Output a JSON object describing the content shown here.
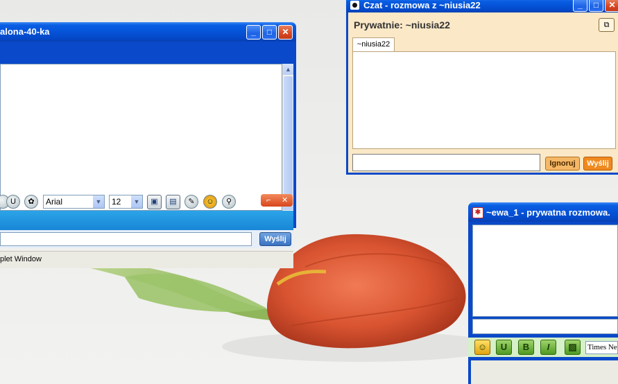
{
  "window_left": {
    "title": "alona-40-ka",
    "font_select": "Arial",
    "size_select": "12",
    "send_label": "Wyślij",
    "status_text": "plet Window",
    "colors": {
      "toolbar": "#1886d6",
      "close_badge": "#e25a2d"
    }
  },
  "window_czat": {
    "title": "Czat - rozmowa z ~niusia22",
    "heading": "Prywatnie: ~niusia22",
    "tab_label": "~niusia22",
    "ignore_label": "Ignoruj",
    "send_label": "Wyślij",
    "colors": {
      "panel": "#fae8c7",
      "ignore_button": "#f5b866",
      "send_button": "#f08a1e"
    }
  },
  "window_ewa": {
    "title": "~ewa_1 - prywatna rozmowa.",
    "font_select": "Times Ne",
    "format_buttons": [
      "U",
      "B",
      "I"
    ],
    "colors": {
      "format_button": "#6fb33a"
    }
  },
  "icons": [
    "minimize-icon",
    "maximize-icon",
    "close-icon",
    "emoticon-icon",
    "search-icon",
    "save-icon",
    "pencil-icon",
    "image-icon"
  ]
}
